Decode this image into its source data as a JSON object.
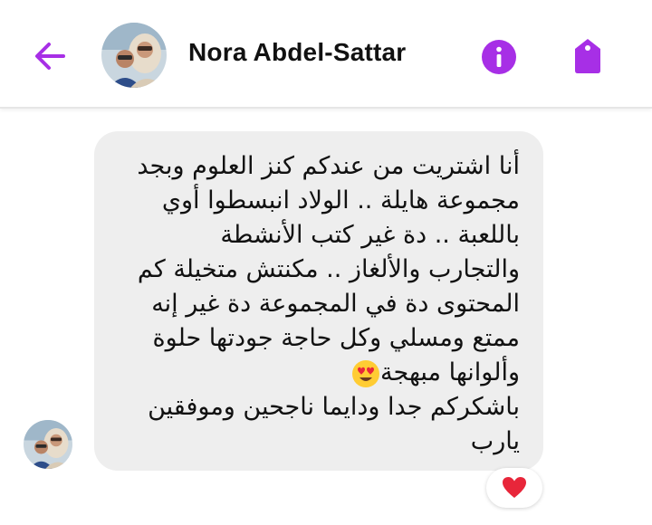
{
  "header": {
    "contact_name": "Nora Abdel-Sattar",
    "icons": {
      "back": "arrow-left-icon",
      "info": "info-icon",
      "tag": "tag-icon"
    },
    "accent_color": "#a72fe6"
  },
  "message": {
    "lines": [
      "أنا اشتريت من عندكم كنز العلوم وبجد",
      "مجموعة هايلة .. الولاد انبسطوا أوي",
      "باللعبة .. دة غير كتب الأنشطة",
      "والتجارب والألغاز .. مكنتش متخيلة كم",
      "المحتوى دة في المجموعة دة غير إنه",
      "ممتع ومسلي وكل حاجة جودتها حلوة",
      "وألوانها مبهجة",
      "باشكركم جدا ودايما ناجحين وموفقين",
      "يارب"
    ],
    "emoji": "heart-eyes-emoji",
    "reaction": "red-heart-emoji",
    "bubble_color": "#eeeeee"
  }
}
